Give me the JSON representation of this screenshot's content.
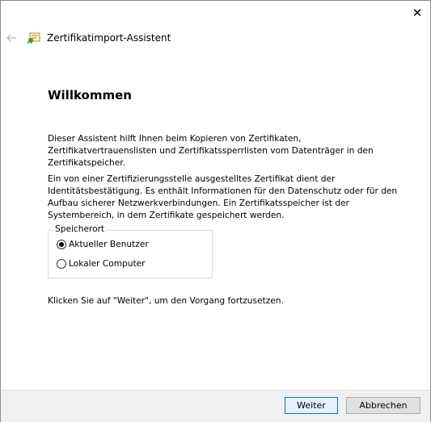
{
  "window": {
    "title": "Zertifikatimport-Assistent",
    "close_glyph": "✕"
  },
  "content": {
    "heading": "Willkommen",
    "paragraph1": "Dieser Assistent hilft Ihnen beim Kopieren von Zertifikaten, Zertifikatvertrauenslisten und Zertifikatssperrlisten vom Datenträger in den Zertifikatspeicher.",
    "paragraph2": "Ein von einer Zertifizierungsstelle ausgestelltes Zertifikat dient der Identitätsbestätigung. Es enthält Informationen für den Datenschutz oder für den Aufbau sicherer Netzwerkverbindungen. Ein Zertifikatsspeicher ist der Systembereich, in dem Zertifikate gespeichert werden.",
    "storage_group": {
      "label": "Speicherort",
      "options": [
        {
          "label": "Aktueller Benutzer",
          "checked": true
        },
        {
          "label": "Lokaler Computer",
          "checked": false
        }
      ]
    },
    "paragraph3": "Klicken Sie auf \"Weiter\", um den Vorgang fortzusetzen."
  },
  "buttons": {
    "next": "Weiter",
    "cancel": "Abbrechen"
  },
  "colors": {
    "accent": "#0078d7",
    "footer_bg": "#f0f0f0"
  },
  "icons": {
    "back": "back-arrow-icon",
    "certificate": "certificate-icon",
    "close": "close-icon"
  }
}
